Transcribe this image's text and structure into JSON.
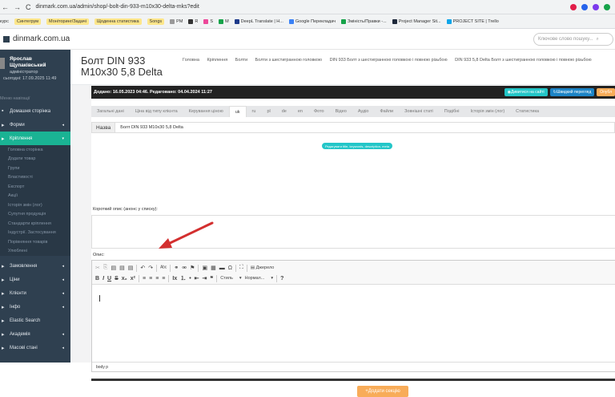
{
  "browser": {
    "url": "dinmark.com.ua/admin/shop/-bolt-din-933-m10x30-delta-mks?edit",
    "nav": [
      "←",
      "→",
      "C"
    ]
  },
  "bookmarks": [
    {
      "label": "курс",
      "color": "#fff"
    },
    {
      "label": "Синтегрум",
      "color": "#fde68a"
    },
    {
      "label": "Моніторинг/Задачі",
      "color": "#fde68a"
    },
    {
      "label": "Щоденна статистика",
      "color": "#fde68a"
    },
    {
      "label": "Songs",
      "color": "#fde68a"
    },
    {
      "label": "PM",
      "color": "none"
    },
    {
      "label": "R",
      "color": "none"
    },
    {
      "label": "S",
      "color": "none"
    },
    {
      "label": "M",
      "color": "none"
    },
    {
      "label": "DeepL Translate | H...",
      "color": "none"
    },
    {
      "label": "Google Перекладач",
      "color": "none"
    },
    {
      "label": "Зміність/Правки -...",
      "color": "none"
    },
    {
      "label": "Project Manager Sit...",
      "color": "none"
    },
    {
      "label": "PROJECT SITE | Trello",
      "color": "none"
    }
  ],
  "topnav": {
    "site": "dinmark.com.ua",
    "search_placeholder": "Ключове слово пошуку..."
  },
  "sidebar": {
    "user_name_1": "Ярослав",
    "user_name_2": "Щупаківський",
    "user_role": "адміністратор",
    "user_time": "сьогодні: 17.09.2025 11:49",
    "section": "Меню навігації",
    "items": [
      {
        "label": "Домашня сторінка",
        "caret": ""
      },
      {
        "label": "Форми",
        "caret": "◂"
      },
      {
        "label": "Кріплення",
        "caret": "▾",
        "active": true
      }
    ],
    "subitems": [
      "Головна сторінка",
      "Додати товар",
      "Групи",
      "Властивості",
      "Експорт",
      "Акції",
      "Історія змін (лог)",
      "Супутня продукція",
      "Стандарти кріплення",
      "Індустрії. Застосування",
      "Порівняння товарів",
      "Улюблені"
    ],
    "items2": [
      {
        "label": "Замовлення",
        "caret": "◂"
      },
      {
        "label": "Ціни",
        "caret": "◂"
      },
      {
        "label": "Клієнти",
        "caret": "◂"
      },
      {
        "label": "Інфо",
        "caret": "◂"
      },
      {
        "label": "Elastic Search",
        "caret": ""
      },
      {
        "label": "Академія",
        "caret": "◂"
      },
      {
        "label": "Масові стані",
        "caret": "◂"
      }
    ]
  },
  "header": {
    "title": "Болт DIN 933 M10x30 5,8 Delta",
    "breadcrumbs": [
      "Головна",
      "Кріплення",
      "Болти",
      "Болти з шестигранною головкою",
      "DIN 933 Болт з шестигранною головкою і повною різьбою",
      "DIN 933 5,8 Delta Болт з шестигранною головкою і повною різьбою"
    ]
  },
  "infobar": {
    "text": "Додано: 16.05.2023 04:46. Редаговано: 04.04.2024 11:27",
    "btn_view": "Дивитися на сайті",
    "btn_quick": "Швидкий перегляд",
    "btn_orange": "Опубл",
    "colors": {
      "view": "#23c6c8",
      "quick": "#1c84c6",
      "orange": "#f8ac59"
    }
  },
  "tabs": [
    "Загальні дані",
    "Ціна від типу клієнта",
    "Керування ціною",
    "uk",
    "ru",
    "pl",
    "de",
    "en",
    "Фото",
    "Відео",
    "Аудіо",
    "Файли",
    "Зовнішні статі",
    "Подібні",
    "Історія змін (лог)",
    "Статистика"
  ],
  "active_tab_index": 3,
  "form": {
    "name_label": "Назва",
    "name_value": "Болт DIN 933 M10x30 5,8 Delta",
    "seo_badge": "Редагувати title, keywords, description, meta",
    "short_label": "Короткий опис (анонс у списку):",
    "desc_label": "Опис:",
    "source_label": "Джерело",
    "style_label": "Стиль",
    "format_label": "Нормал...",
    "help": "?",
    "status_path": "body  p",
    "add_section": "Додати секцію"
  }
}
